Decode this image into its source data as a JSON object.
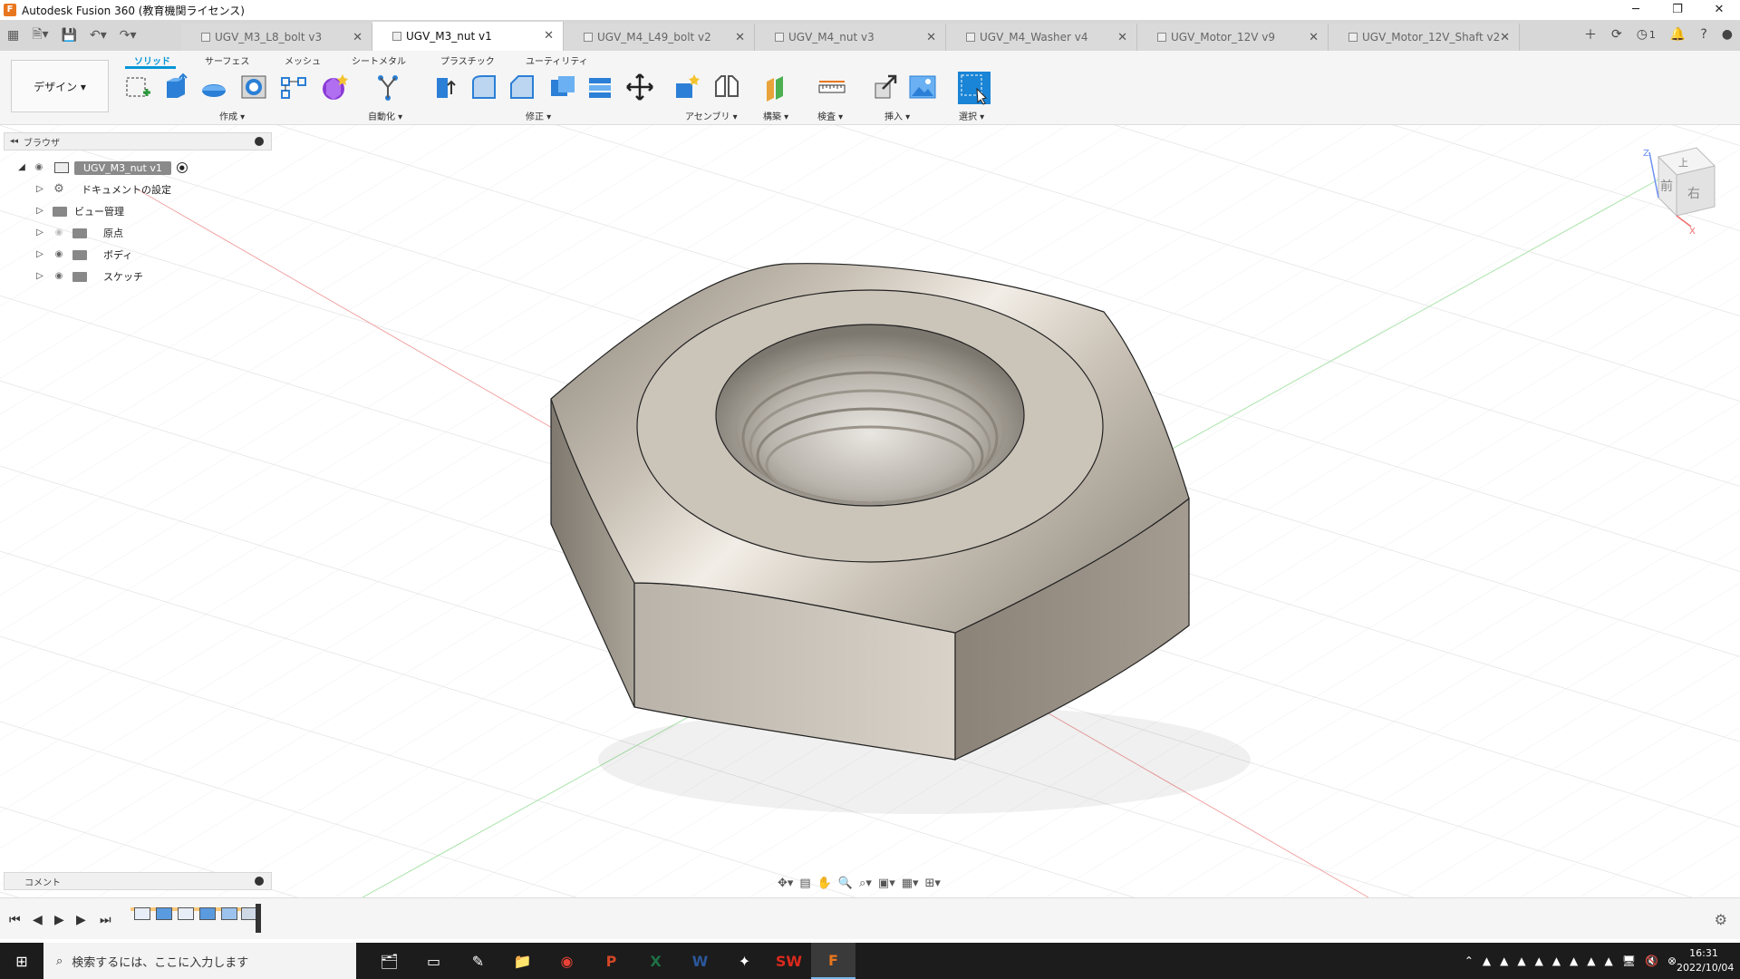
{
  "window": {
    "title": "Autodesk Fusion 360 (教育機関ライセンス)",
    "controls": [
      "─",
      "❐",
      "✕"
    ]
  },
  "tabs": [
    {
      "label": "UGV_M3_L8_bolt v3",
      "active": false
    },
    {
      "label": "UGV_M3_nut v1",
      "active": true
    },
    {
      "label": "UGV_M4_L49_bolt v2",
      "active": false
    },
    {
      "label": "UGV_M4_nut v3",
      "active": false
    },
    {
      "label": "UGV_M4_Washer v4",
      "active": false
    },
    {
      "label": "UGV_Motor_12V v9",
      "active": false
    },
    {
      "label": "UGV_Motor_12V_Shaft v2",
      "active": false
    }
  ],
  "tabbar_right": {
    "job_count": "1"
  },
  "ribbon": {
    "workspace": "デザイン ▾",
    "tabs": [
      "ソリッド",
      "サーフェス",
      "メッシュ",
      "シートメタル",
      "プラスチック",
      "ユーティリティ"
    ],
    "groups": [
      "作成 ▾",
      "自動化 ▾",
      "修正 ▾",
      "アセンブリ ▾",
      "構築 ▾",
      "検査 ▾",
      "挿入 ▾",
      "選択 ▾"
    ]
  },
  "browser": {
    "title": "ブラウザ",
    "root": "UGV_M3_nut v1",
    "items": [
      "ドキュメントの設定",
      "ビュー管理",
      "原点",
      "ボディ",
      "スケッチ"
    ]
  },
  "comments": {
    "title": "コメント"
  },
  "viewcube": {
    "top": "上",
    "front": "前",
    "right": "右",
    "z_axis": "Z",
    "x_axis": "X"
  },
  "taskbar": {
    "search_placeholder": "検索するには、ここに入力します",
    "time": "16:31",
    "date": "2022/10/04"
  }
}
